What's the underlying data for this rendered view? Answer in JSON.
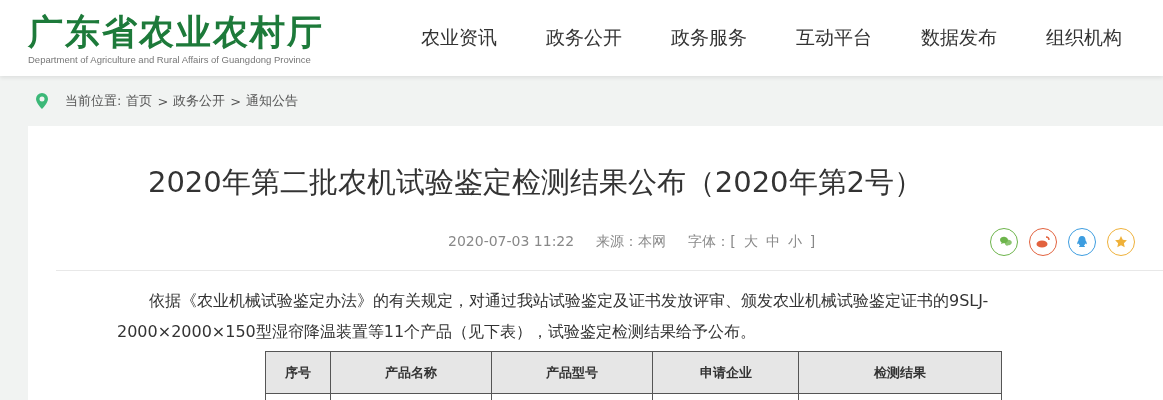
{
  "header": {
    "logo_title": "广东省农业农村厅",
    "logo_subtitle": "Department of Agriculture and Rural Affairs of Guangdong Province",
    "nav": [
      {
        "label": "农业资讯"
      },
      {
        "label": "政务公开"
      },
      {
        "label": "政务服务"
      },
      {
        "label": "互动平台"
      },
      {
        "label": "数据发布"
      },
      {
        "label": "组织机构"
      }
    ]
  },
  "breadcrumb": {
    "label": "当前位置:",
    "items": [
      "首页",
      "政务公开",
      "通知公告"
    ],
    "separator": ">"
  },
  "article": {
    "title": "2020年第二批农机试验鉴定检测结果公布（2020年第2号）",
    "date": "2020-07-03 11:22",
    "source": "来源：本网",
    "font_label": "字体：[",
    "font_sizes": [
      "大",
      "中",
      "小"
    ],
    "font_close": "]",
    "share": [
      {
        "kind": "chat",
        "color": "#6db44b"
      },
      {
        "kind": "swirl",
        "color": "#e2623e"
      },
      {
        "kind": "penguin",
        "color": "#3d9de0"
      },
      {
        "kind": "star",
        "color": "#efb13a"
      }
    ],
    "paragraph": "依据《农业机械试验鉴定办法》的有关规定，对通过我站试验鉴定及证书发放评审、颁发农业机械试验鉴定证书的9SLJ-2000×2000×150型湿帘降温装置等11个产品（见下表），试验鉴定检测结果给予公布。",
    "table": {
      "columns": [
        "序号",
        "产品名称",
        "产品型号",
        "申请企业",
        "检测结果"
      ]
    }
  }
}
